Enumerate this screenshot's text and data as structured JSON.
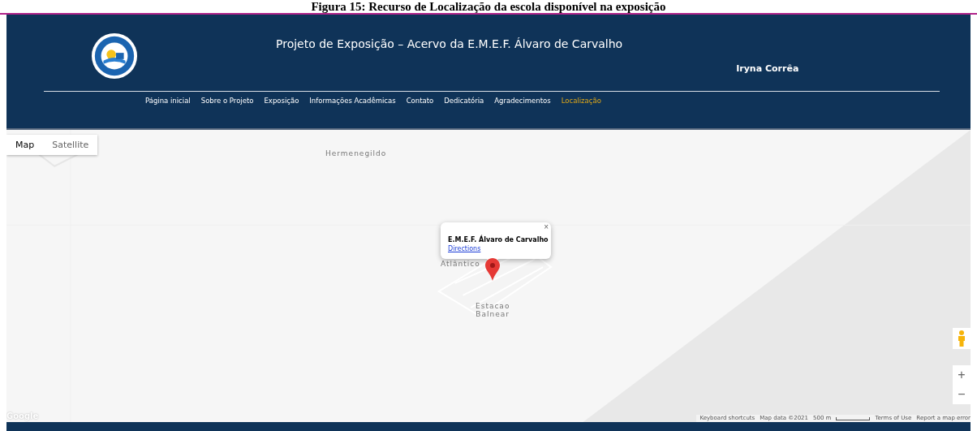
{
  "caption": "Figura 15: Recurso de Localização da escola disponível na exposição",
  "header": {
    "title": "Projeto de Exposição – Acervo da E.M.E.F. Álvaro de Carvalho",
    "user": "Iryna Corrêa"
  },
  "nav": [
    {
      "label": "Página inicial",
      "selected": false
    },
    {
      "label": "Sobre o Projeto",
      "selected": false
    },
    {
      "label": "Exposição",
      "selected": false
    },
    {
      "label": "Informações Acadêmicas",
      "selected": false
    },
    {
      "label": "Contato",
      "selected": false
    },
    {
      "label": "Dedicatória",
      "selected": false
    },
    {
      "label": "Agradecimentos",
      "selected": false
    },
    {
      "label": "Localização",
      "selected": true
    }
  ],
  "map": {
    "types": [
      {
        "label": "Map",
        "selected": true
      },
      {
        "label": "Satellite",
        "selected": false
      }
    ],
    "places": [
      "Hermenegildo",
      "Atlântico",
      "Estacao\nBalnear"
    ],
    "popup": {
      "title": "E.M.E.F. Álvaro de Carvalho",
      "link": "Directions",
      "close": "×"
    },
    "zoom": [
      "+",
      "−"
    ],
    "logo": "Google",
    "attribution": [
      "Keyboard shortcuts",
      "Map data ©2021",
      "500 m",
      "Terms of Use",
      "Report a map error"
    ]
  }
}
